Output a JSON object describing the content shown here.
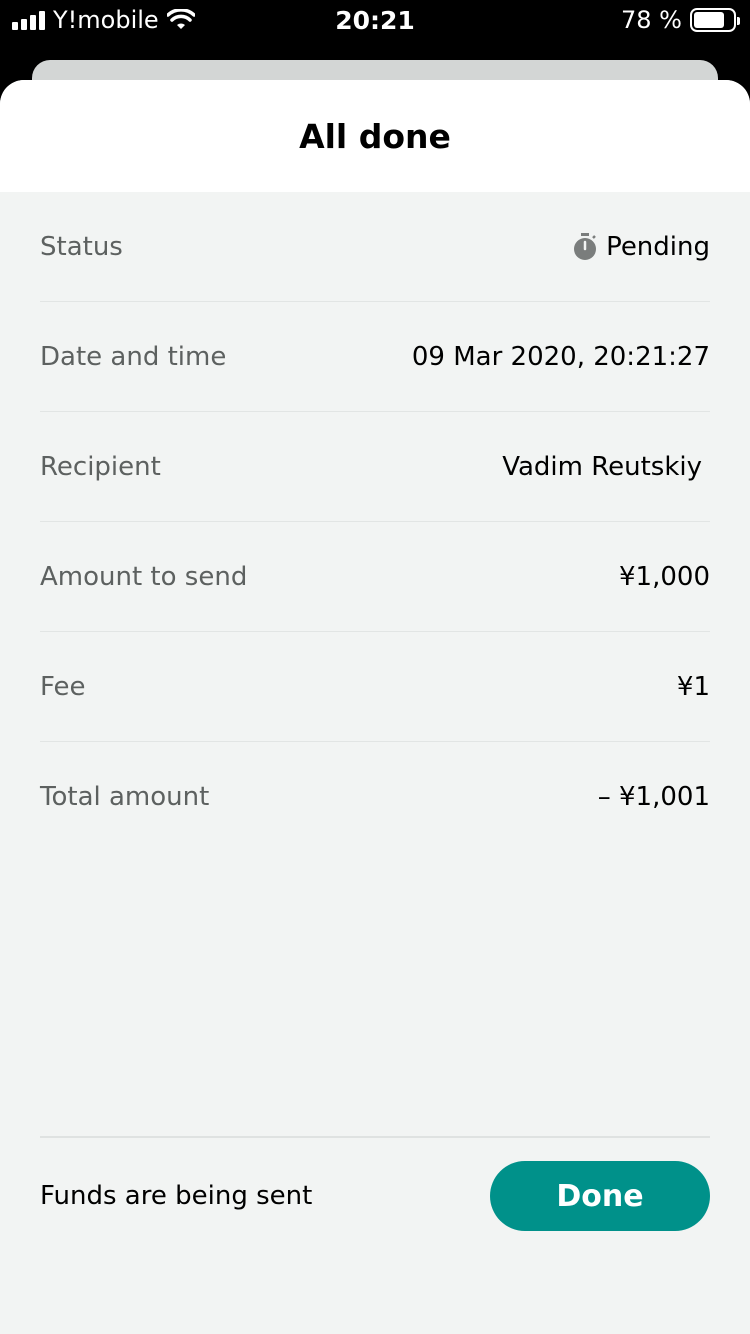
{
  "status_bar": {
    "carrier": "Y!mobile",
    "time": "20:21",
    "battery_text": "78 %",
    "battery_level": 0.78,
    "icons": [
      "signal-icon",
      "wifi-icon",
      "battery-icon"
    ]
  },
  "sheet": {
    "title": "All done"
  },
  "details": [
    {
      "label": "Status",
      "value": "Pending",
      "icon": "timer-icon"
    },
    {
      "label": "Date and time",
      "value": "09 Mar 2020, 20:21:27"
    },
    {
      "label": "Recipient",
      "value": "Vadim Reutskiy"
    },
    {
      "label": "Amount to send",
      "value": "¥1,000"
    },
    {
      "label": "Fee",
      "value": "¥1"
    },
    {
      "label": "Total amount",
      "value": "– ¥1,001"
    }
  ],
  "footer": {
    "message": "Funds are being sent",
    "done_label": "Done"
  },
  "colors": {
    "accent": "#00918a",
    "background": "#f2f4f3",
    "label": "#5d6160"
  }
}
